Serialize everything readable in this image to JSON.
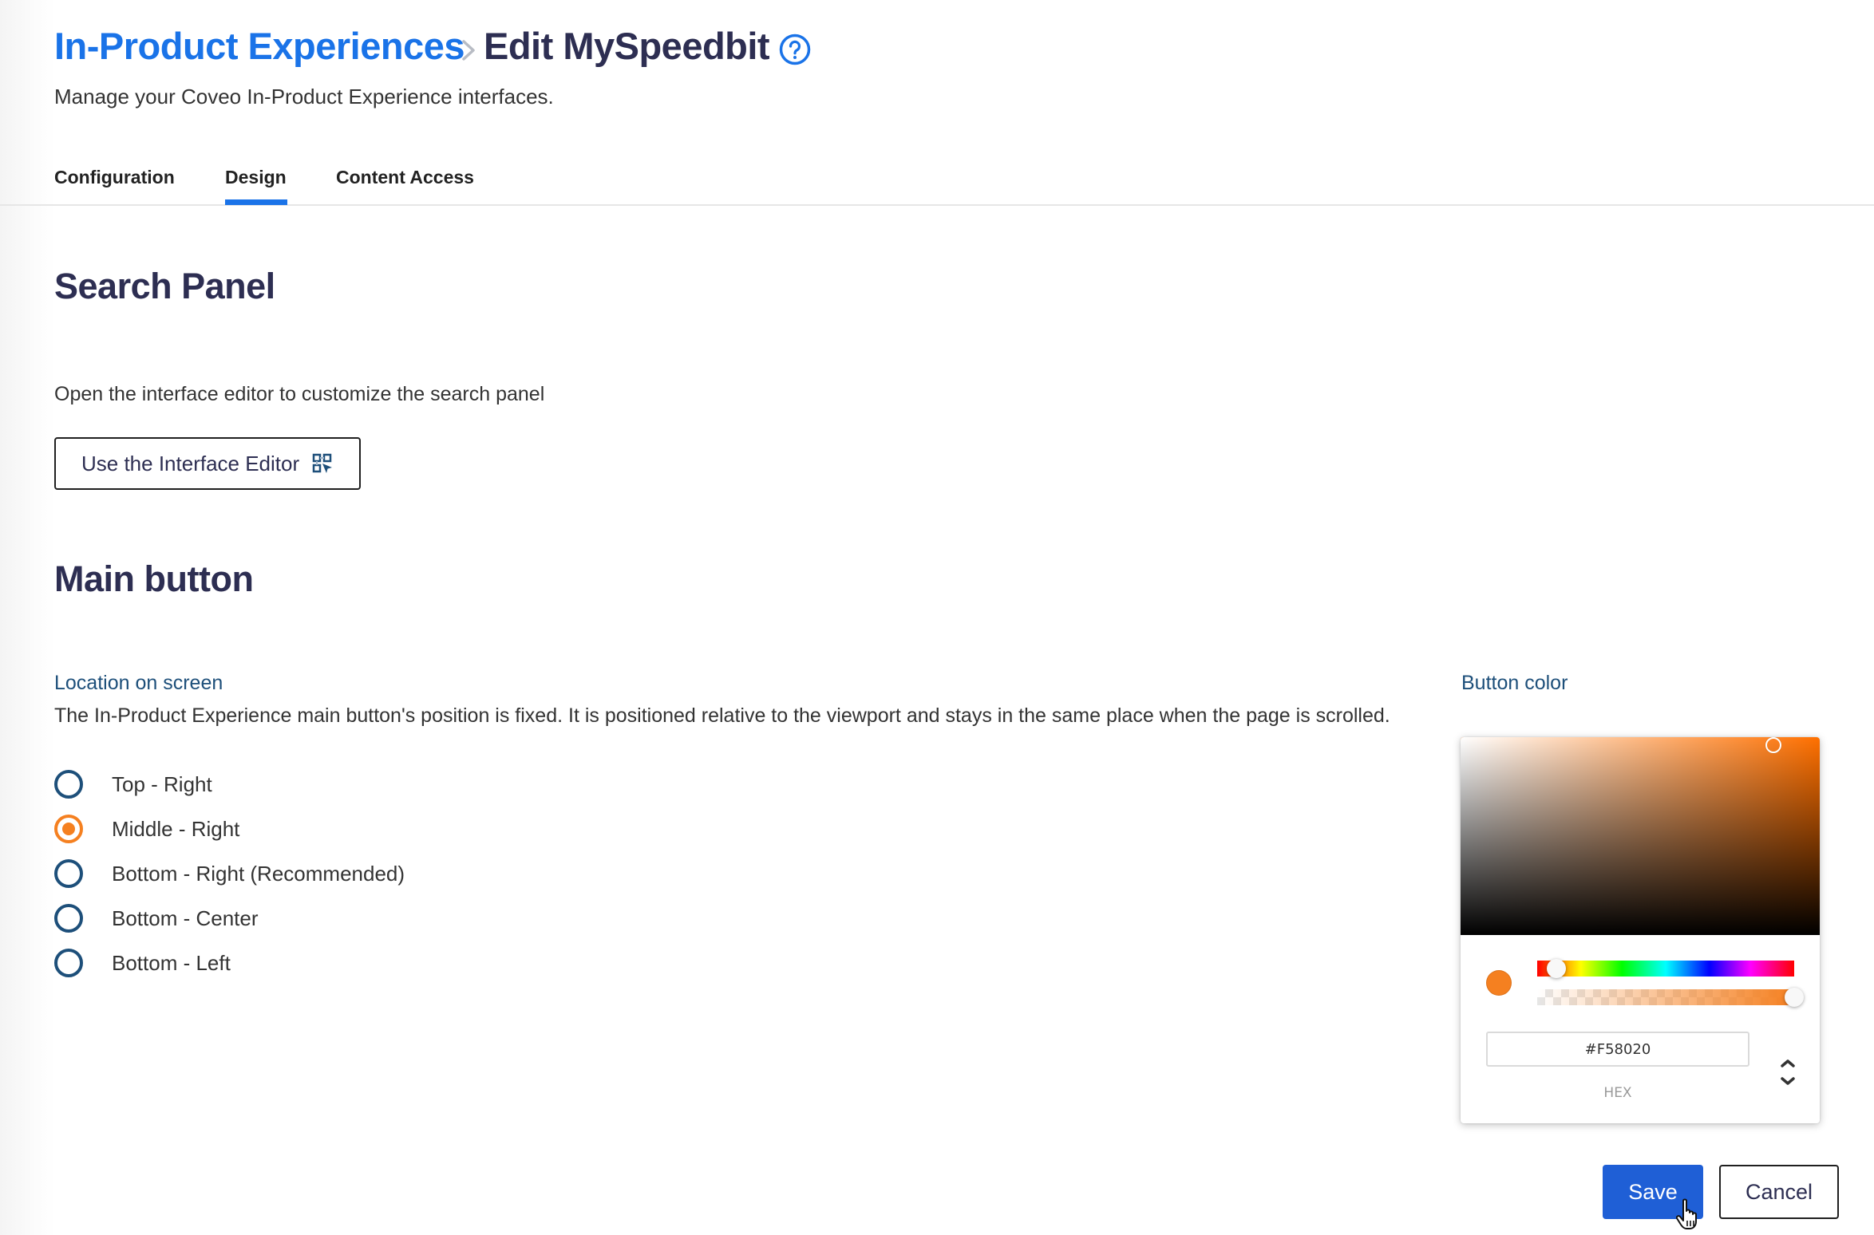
{
  "header": {
    "breadcrumb_parent": "In-Product Experiences",
    "breadcrumb_separator_icon": "chevron-right-icon",
    "title": "Edit MySpeedbit",
    "help_icon": "question-circle-icon",
    "subtitle": "Manage your Coveo In-Product Experience interfaces."
  },
  "tabs": [
    {
      "label": "Configuration",
      "active": false
    },
    {
      "label": "Design",
      "active": true
    },
    {
      "label": "Content Access",
      "active": false
    }
  ],
  "search_panel": {
    "heading": "Search Panel",
    "description": "Open the interface editor to customize the search panel",
    "editor_button_label": "Use the Interface Editor",
    "editor_button_icon": "interface-editor-icon"
  },
  "main_button": {
    "heading": "Main button",
    "location": {
      "label": "Location on screen",
      "description": "The In-Product Experience main button's position is fixed. It is positioned relative to the viewport and stays in the same place when the page is scrolled.",
      "options": [
        {
          "label": "Top - Right",
          "checked": false
        },
        {
          "label": "Middle - Right",
          "checked": true
        },
        {
          "label": "Bottom - Right (Recommended)",
          "checked": false
        },
        {
          "label": "Bottom - Center",
          "checked": false
        },
        {
          "label": "Bottom - Left",
          "checked": false
        }
      ]
    },
    "color": {
      "label": "Button color",
      "hex_value": "#F58020",
      "format_label": "HEX",
      "hue_degrees": 27,
      "saturation_percent": 87,
      "brightness_percent": 96,
      "alpha_percent": 100
    }
  },
  "colors": {
    "brand_blue": "#1a73e8",
    "primary_button": "#1f5fd6",
    "heading_navy": "#2d2e52",
    "label_blue": "#1d4f7a",
    "selected_accent": "#f58020"
  },
  "actions": {
    "save_label": "Save",
    "cancel_label": "Cancel"
  }
}
